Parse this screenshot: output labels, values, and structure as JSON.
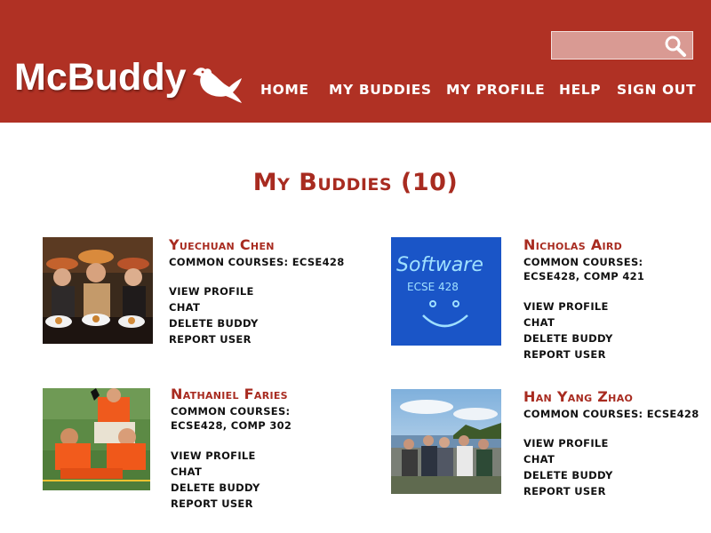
{
  "app": {
    "logo": "McBuddy"
  },
  "search": {
    "placeholder": ""
  },
  "nav": [
    "HOME",
    "MY BUDDIES",
    "MY PROFILE",
    "HELP",
    "SIGN OUT"
  ],
  "page": {
    "title": "My Buddies (10)"
  },
  "actions": {
    "view_profile": "VIEW PROFILE",
    "chat": "CHAT",
    "delete": "DELETE BUDDY",
    "report": "REPORT USER"
  },
  "buddies": [
    {
      "name": "Yuechuan Chen",
      "courses": "COMMON COURSES: ECSE428"
    },
    {
      "name": "Nicholas Aird",
      "courses": "COMMON COURSES: ECSE428, COMP 421",
      "photo_text": [
        "Software",
        "ECSE 428"
      ]
    },
    {
      "name": "Nathaniel Faries",
      "courses": "COMMON COURSES: ECSE428, COMP 302"
    },
    {
      "name": "Han Yang Zhao",
      "courses": "COMMON COURSES: ECSE428"
    }
  ],
  "colors": {
    "header": "#b03124",
    "accent": "#a82b20",
    "search_bg": "#d99a93"
  }
}
